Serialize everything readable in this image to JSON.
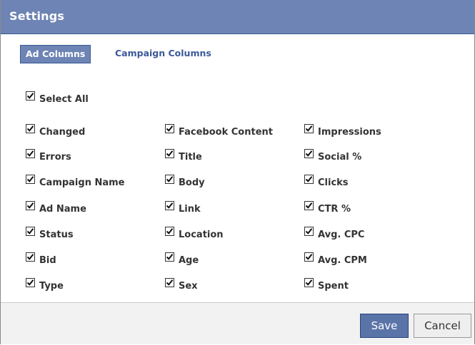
{
  "dialog": {
    "title": "Settings"
  },
  "tabs": {
    "ad_columns": "Ad Columns",
    "campaign_columns": "Campaign Columns"
  },
  "select_all": {
    "label": "Select All",
    "checked": true
  },
  "columns": {
    "col1": [
      "Changed",
      "Errors",
      "Campaign Name",
      "Ad Name",
      "Status",
      "Bid",
      "Type"
    ],
    "col2": [
      "Facebook Content",
      "Title",
      "Body",
      "Link",
      "Location",
      "Age",
      "Sex"
    ],
    "col3": [
      "Impressions",
      "Social %",
      "Clicks",
      "CTR %",
      "Avg. CPC",
      "Avg. CPM",
      "Spent"
    ]
  },
  "buttons": {
    "save": "Save",
    "cancel": "Cancel"
  },
  "colors": {
    "titlebar": "#6d84b4",
    "active_tab": "#6d84b4",
    "link": "#3b5998",
    "save_button": "#5b74a8"
  }
}
